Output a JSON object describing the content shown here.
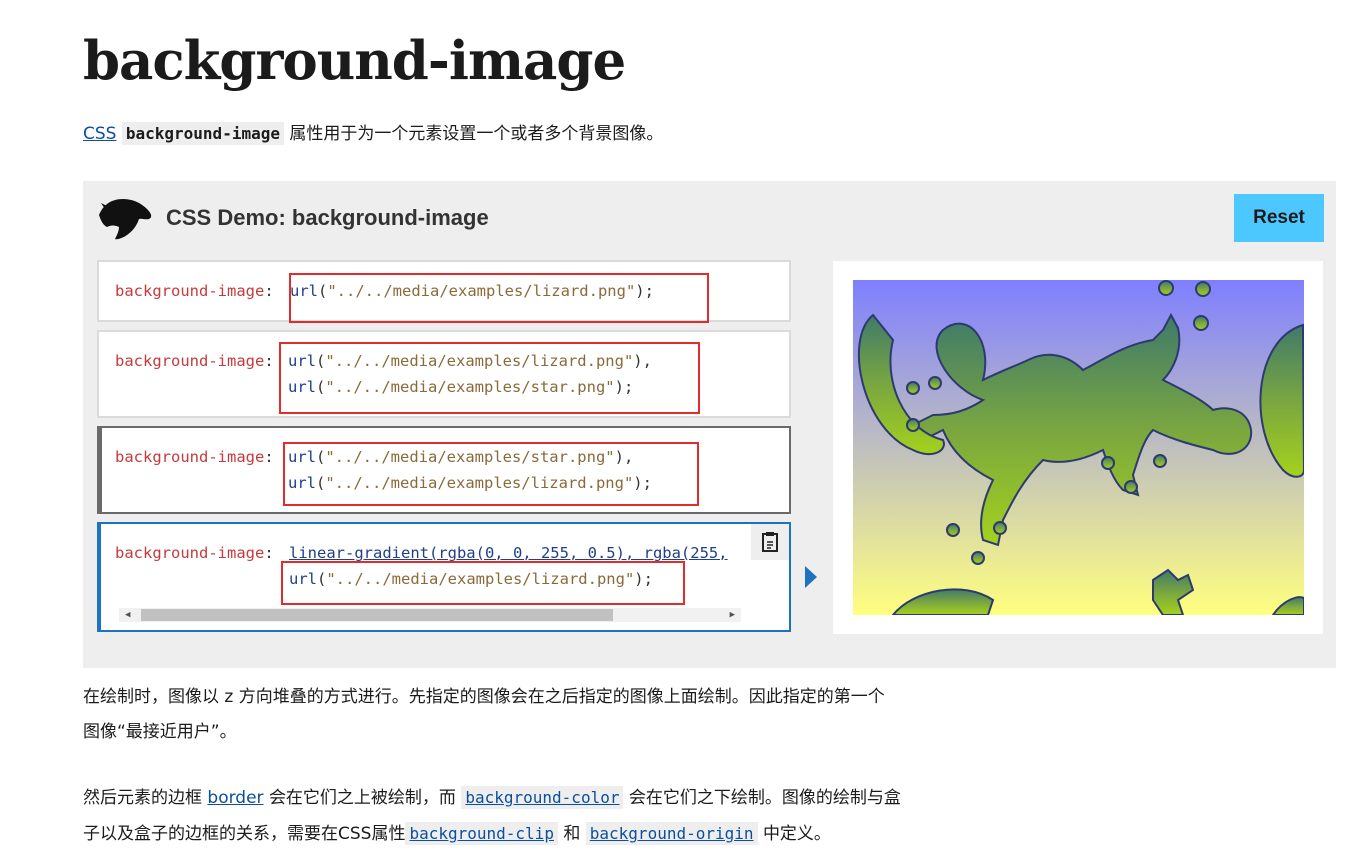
{
  "page": {
    "title": "background-image",
    "intro": {
      "link": "CSS",
      "code": "background-image",
      "text": "属性用于为一个元素设置一个或者多个背景图像。"
    }
  },
  "demo": {
    "title": "CSS Demo: background-image",
    "reset_label": "Reset",
    "prop": "background-image",
    "choices": [
      {
        "lines": [
          "url(\"../../media/examples/lizard.png\");"
        ]
      },
      {
        "lines": [
          "url(\"../../media/examples/lizard.png\"),",
          "url(\"../../media/examples/star.png\");"
        ]
      },
      {
        "lines": [
          "url(\"../../media/examples/star.png\"),",
          "url(\"../../media/examples/lizard.png\");"
        ]
      },
      {
        "lines": [
          "linear-gradient(rgba(0, 0, 255, 0.5), rgba(255,",
          "url(\"../../media/examples/lizard.png\");"
        ]
      }
    ],
    "colors": {
      "reset": "#4dc8ff",
      "accent": "#1e73be",
      "highlight": "#e22b2b"
    },
    "icons": [
      "mdn-dino-logo-icon",
      "copy-clipboard-icon",
      "play-arrow-icon"
    ]
  },
  "body": {
    "p1_line1": "在绘制时，图像以 z 方向堆叠的方式进行。先指定的图像会在之后指定的图像上面绘制。因此指定的第一个",
    "p1_line2": "图像“最接近用户”。",
    "p2_a": "然后元素的边框",
    "p2_border": "border",
    "p2_b": "会在它们之上被绘制，而",
    "p2_bgcolor": "background-color",
    "p2_c": "会在它们之下绘制。图像的绘制与盒",
    "p2_d": "子以及盒子的边框的关系，需要在CSS属性",
    "p2_bgclip": "background-clip",
    "p2_e": "和",
    "p2_bgorigin": "background-origin",
    "p2_f": "中定义。"
  }
}
